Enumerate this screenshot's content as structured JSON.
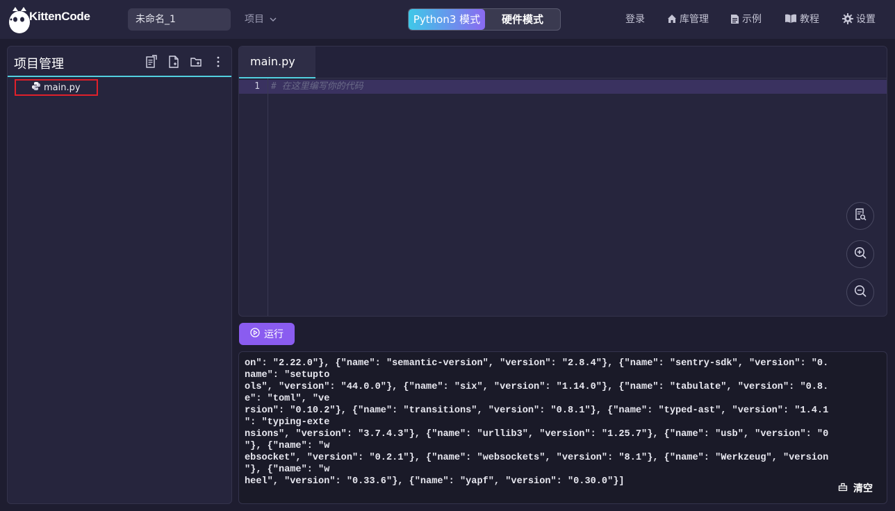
{
  "app": {
    "logo_text": "KittenCode"
  },
  "header": {
    "project_name": "未命名_1",
    "project_menu": "项目",
    "mode_python": "Python3 模式",
    "mode_hardware": "硬件模式",
    "nav": {
      "login": "登录",
      "library": "库管理",
      "examples": "示例",
      "tutorial": "教程",
      "settings": "设置"
    }
  },
  "sidebar": {
    "title": "项目管理",
    "files": [
      {
        "name": "main.py"
      }
    ]
  },
  "editor": {
    "tab": "main.py",
    "lines": [
      {
        "no": "1",
        "text": "# 在这里编写你的代码"
      }
    ]
  },
  "run_label": "运行",
  "console": {
    "lines": [
      "on\": \"2.22.0\"}, {\"name\": \"semantic-version\", \"version\": \"2.8.4\"}, {\"name\": \"sentry-sdk\", \"version\": \"0.",
      "name\": \"setupto",
      "ols\", \"version\": \"44.0.0\"}, {\"name\": \"six\", \"version\": \"1.14.0\"}, {\"name\": \"tabulate\", \"version\": \"0.8.",
      "e\": \"toml\", \"ve",
      "rsion\": \"0.10.2\"}, {\"name\": \"transitions\", \"version\": \"0.8.1\"}, {\"name\": \"typed-ast\", \"version\": \"1.4.1",
      "\": \"typing-exte",
      "nsions\", \"version\": \"3.7.4.3\"}, {\"name\": \"urllib3\", \"version\": \"1.25.7\"}, {\"name\": \"usb\", \"version\": \"0",
      "\"}, {\"name\": \"w",
      "ebsocket\", \"version\": \"0.2.1\"}, {\"name\": \"websockets\", \"version\": \"8.1\"}, {\"name\": \"Werkzeug\", \"version",
      "\"}, {\"name\": \"w",
      "heel\", \"version\": \"0.33.6\"}, {\"name\": \"yapf\", \"version\": \"0.30.0\"}]"
    ],
    "clear_label": "清空"
  },
  "colors": {
    "accent": "#8a5cf0",
    "highlight": "#52d0e0",
    "selection_border": "#e0202a"
  },
  "icons": [
    "kitten-logo-icon",
    "chevron-down-icon",
    "home-icon",
    "document-icon",
    "book-icon",
    "gear-icon",
    "new-note-icon",
    "new-file-icon",
    "new-folder-icon",
    "more-vertical-icon",
    "python-icon",
    "search-file-icon",
    "zoom-in-icon",
    "zoom-out-icon",
    "play-circle-icon",
    "trash-icon"
  ]
}
